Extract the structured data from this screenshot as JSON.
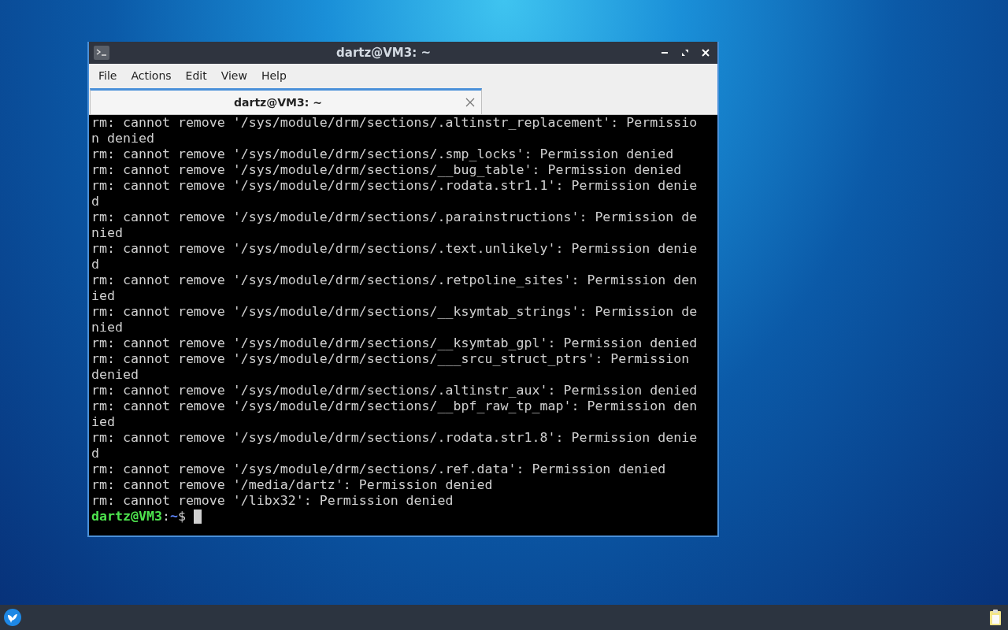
{
  "window": {
    "title": "dartz@VM3: ~"
  },
  "menu": [
    "File",
    "Actions",
    "Edit",
    "View",
    "Help"
  ],
  "tabs": [
    {
      "label": "dartz@VM3: ~",
      "selected": true
    }
  ],
  "terminal": {
    "lines": [
      "rm: cannot remove '/sys/module/drm/sections/.altinstr_replacement': Permission denied",
      "rm: cannot remove '/sys/module/drm/sections/.smp_locks': Permission denied",
      "rm: cannot remove '/sys/module/drm/sections/__bug_table': Permission denied",
      "rm: cannot remove '/sys/module/drm/sections/.rodata.str1.1': Permission denied",
      "rm: cannot remove '/sys/module/drm/sections/.parainstructions': Permission denied",
      "rm: cannot remove '/sys/module/drm/sections/.text.unlikely': Permission denied",
      "rm: cannot remove '/sys/module/drm/sections/.retpoline_sites': Permission denied",
      "rm: cannot remove '/sys/module/drm/sections/__ksymtab_strings': Permission denied",
      "rm: cannot remove '/sys/module/drm/sections/__ksymtab_gpl': Permission denied",
      "rm: cannot remove '/sys/module/drm/sections/___srcu_struct_ptrs': Permission denied",
      "rm: cannot remove '/sys/module/drm/sections/.altinstr_aux': Permission denied",
      "rm: cannot remove '/sys/module/drm/sections/__bpf_raw_tp_map': Permission denied",
      "rm: cannot remove '/sys/module/drm/sections/.rodata.str1.8': Permission denied",
      "rm: cannot remove '/sys/module/drm/sections/.ref.data': Permission denied",
      "rm: cannot remove '/media/dartz': Permission denied",
      "rm: cannot remove '/libx32': Permission denied"
    ],
    "prompt": {
      "user": "dartz@VM3",
      "separator": ":",
      "path": "~",
      "symbol": "$"
    }
  }
}
